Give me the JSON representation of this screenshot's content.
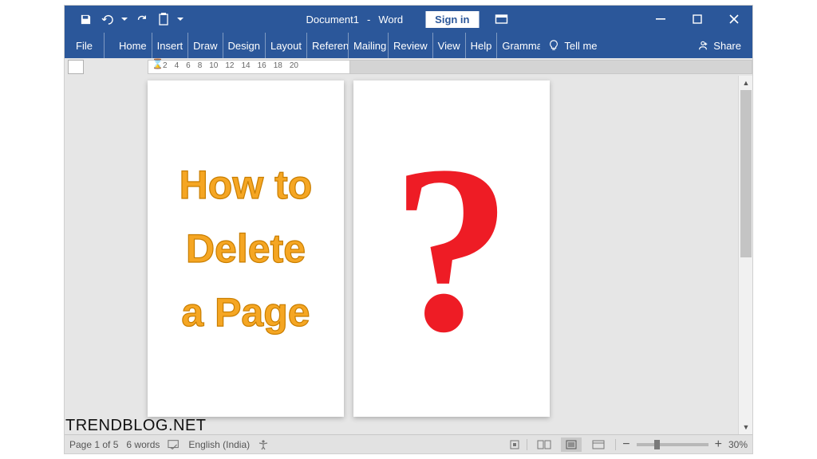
{
  "title": {
    "doc": "Document1",
    "app": "Word"
  },
  "signin": "Sign in",
  "tabs": {
    "file": "File",
    "items": [
      "Home",
      "Insert",
      "Draw",
      "Design",
      "Layout",
      "Referen",
      "Mailing",
      "Review",
      "View",
      "Help",
      "Gramma"
    ],
    "tellme": "Tell me",
    "share": "Share"
  },
  "ruler": {
    "nums": [
      "2",
      "4",
      "6",
      "8",
      "10",
      "12",
      "14",
      "16",
      "18",
      "20"
    ]
  },
  "page1": {
    "line1": "How to",
    "line2": "Delete",
    "line3": "a Page"
  },
  "page2": {
    "symbol": "?"
  },
  "status": {
    "page": "Page 1 of 5",
    "words": "6 words",
    "language": "English (India)",
    "zoom": "30%"
  },
  "watermark": "TRENDBLOG.NET",
  "colors": {
    "brand": "#2b579a",
    "accent_text": "#f5a623",
    "qmark": "#ee1c25"
  }
}
